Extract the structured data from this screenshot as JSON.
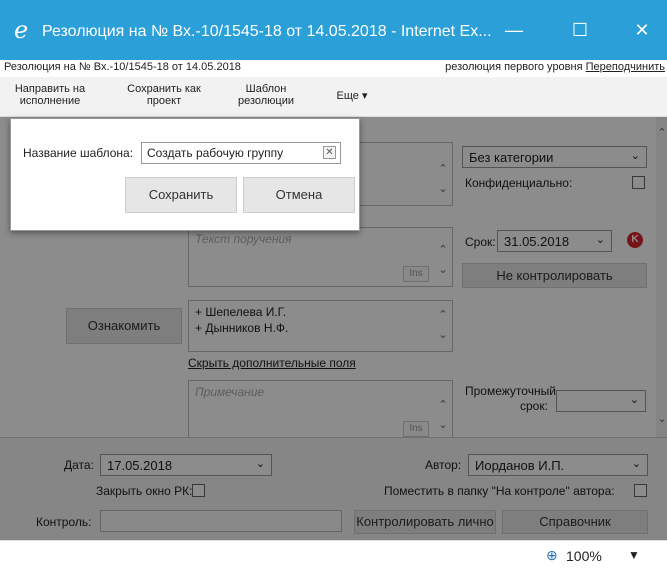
{
  "window": {
    "title": "Резолюция на № Вх.-10/1545-18 от 14.05.2018 - Internet Ex...",
    "icon": "ie-icon",
    "minimize": "—",
    "maximize": "☐",
    "close": "✕"
  },
  "subheader": {
    "doc_title": "Резолюция на № Вх.-10/1545-18 от 14.05.2018",
    "level_text": "резолюция первого уровня",
    "reassign_link": "Переподчинить"
  },
  "toolbar": {
    "send_exec_1": "Направить на",
    "send_exec_2": "исполнение",
    "save_project_1": "Сохранить как",
    "save_project_2": "проект",
    "template_1": "Шаблон",
    "template_2": "резолюции",
    "more": "Еще"
  },
  "form": {
    "category": "Без категории",
    "confidential_label": "Конфиденциально:",
    "task_placeholder": "Текст поручения",
    "ins_label": "Ins",
    "deadline_label": "Срок:",
    "deadline_value": "31.05.2018",
    "no_control_button": "Не контролировать",
    "acquaint_button": "Ознакомить",
    "recipients": [
      "+ Шепелева И.Г.",
      "+ Дынников Н.Ф."
    ],
    "hide_fields_link": "Скрыть дополнительные поля",
    "note_placeholder": "Примечание",
    "interim_deadline_label_1": "Промежуточный",
    "interim_deadline_label_2": "срок:"
  },
  "bottom": {
    "date_label": "Дата:",
    "date_value": "17.05.2018",
    "author_label": "Автор:",
    "author_value": "Иорданов И.П.",
    "close_window_label": "Закрыть окно РК:",
    "put_folder_label": "Поместить в папку \"На контроле\" автора:",
    "control_label": "Контроль:",
    "control_self_button": "Контролировать лично",
    "reference_button": "Справочник"
  },
  "status": {
    "zoom": "100%"
  },
  "dialog": {
    "name_label": "Название шаблона:",
    "name_value": "Создать рабочую группу",
    "save_button": "Сохранить",
    "cancel_button": "Отмена"
  }
}
